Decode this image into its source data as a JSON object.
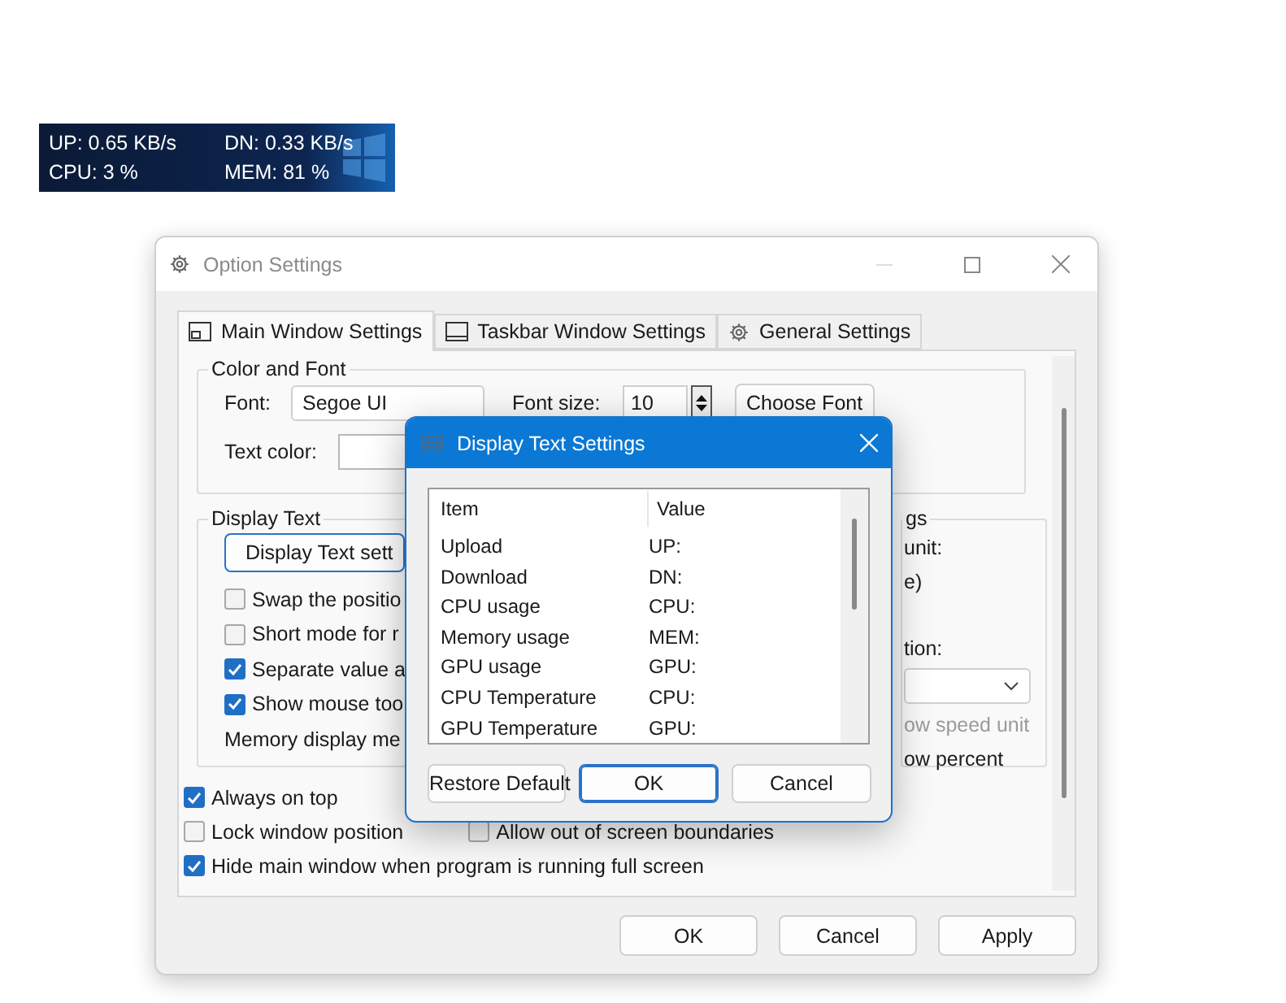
{
  "taskbar_widget": {
    "items": [
      "UP: 0.65 KB/s",
      "DN: 0.33 KB/s",
      "CPU: 3 %",
      "MEM: 81 %"
    ]
  },
  "window": {
    "title": "Option Settings"
  },
  "tabs": [
    {
      "label": "Main Window Settings",
      "selected": true,
      "kind": "window"
    },
    {
      "label": "Taskbar Window Settings",
      "selected": false,
      "kind": "taskbar"
    },
    {
      "label": "General Settings",
      "selected": false,
      "kind": "gear"
    }
  ],
  "color_and_font": {
    "title": "Color and Font",
    "font_label": "Font:",
    "font_value": "Segoe UI",
    "font_size_label": "Font size:",
    "font_size_value": "10",
    "choose_font_button": "Choose Font",
    "text_color_label": "Text color:"
  },
  "display_text": {
    "title": "Display Text",
    "button": "Display Text sett",
    "checkboxes": [
      {
        "label": "Swap the positio",
        "checked": false
      },
      {
        "label": "Short mode for r",
        "checked": false
      },
      {
        "label": "Separate value a",
        "checked": true
      },
      {
        "label": "Show mouse too",
        "checked": true
      }
    ],
    "memory_label": "Memory display me"
  },
  "right_group": {
    "title": "gs",
    "lines": [
      {
        "kind": "label",
        "text": "unit:",
        "disabled": false
      },
      {
        "kind": "label",
        "text": "e)",
        "disabled": false
      },
      {
        "kind": "gap"
      },
      {
        "kind": "label",
        "text": "tion:",
        "disabled": false
      },
      {
        "kind": "dropdown"
      },
      {
        "kind": "label",
        "text": "ow speed unit",
        "disabled": true
      },
      {
        "kind": "label",
        "text": "ow percent",
        "disabled": false
      }
    ]
  },
  "options": [
    {
      "items": [
        {
          "label": "Always on top",
          "checked": true
        }
      ]
    },
    {
      "items": [
        {
          "label": "Lock window position",
          "checked": false
        },
        {
          "label": "Allow out of screen boundaries",
          "checked": false
        }
      ]
    },
    {
      "items": [
        {
          "label": "Hide main window when program is running full screen",
          "checked": true
        }
      ]
    }
  ],
  "footer_buttons": [
    {
      "label": "OK"
    },
    {
      "label": "Cancel"
    },
    {
      "label": "Apply"
    }
  ],
  "dialog": {
    "title": "Display Text Settings",
    "columns": [
      "Item",
      "Value"
    ],
    "rows": [
      [
        "Upload",
        "UP:"
      ],
      [
        "Download",
        "DN:"
      ],
      [
        "CPU usage",
        "CPU:"
      ],
      [
        "Memory usage",
        "MEM:"
      ],
      [
        "GPU usage",
        "GPU:"
      ],
      [
        "CPU Temperature",
        "CPU:"
      ],
      [
        "GPU Temperature",
        "GPU:"
      ]
    ],
    "buttons": [
      {
        "label": "Restore Default",
        "default": false
      },
      {
        "label": "OK",
        "default": true
      },
      {
        "label": "Cancel",
        "default": false
      }
    ]
  }
}
